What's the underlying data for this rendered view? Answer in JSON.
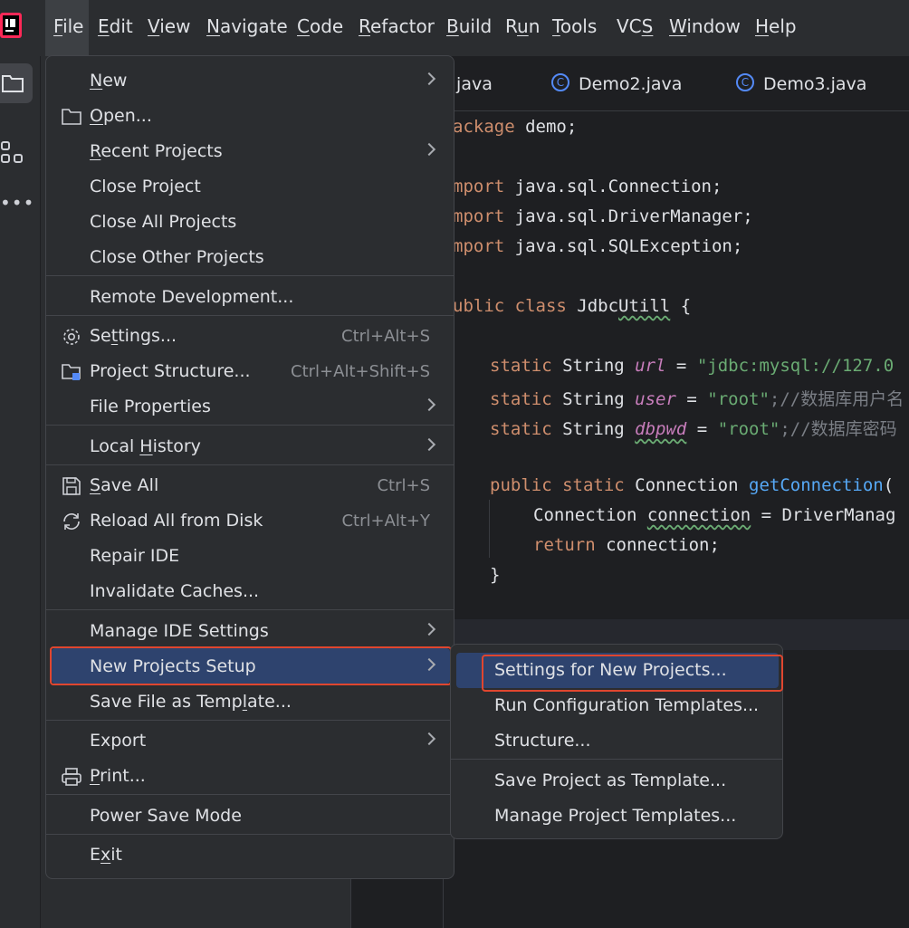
{
  "menubar": {
    "items": [
      {
        "label": "File",
        "mnemonic": "F",
        "rest": "ile"
      },
      {
        "label": "Edit",
        "mnemonic": "E",
        "rest": "dit"
      },
      {
        "label": "View",
        "mnemonic": "V",
        "rest": "iew"
      },
      {
        "label": "Navigate",
        "mnemonic": "N",
        "rest": "avigate"
      },
      {
        "label": "Code",
        "mnemonic": "C",
        "rest": "ode"
      },
      {
        "label": "Refactor",
        "mnemonic": "R",
        "rest": "efactor"
      },
      {
        "label": "Build",
        "mnemonic": "B",
        "rest": "uild"
      },
      {
        "label": "Run",
        "pre": "R",
        "mnemonic": "u",
        "rest": "n"
      },
      {
        "label": "Tools",
        "mnemonic": "T",
        "rest": "ools"
      },
      {
        "label": "VCS",
        "pre": "VC",
        "mnemonic": "S",
        "rest": ""
      },
      {
        "label": "Window",
        "mnemonic": "W",
        "rest": "indow"
      },
      {
        "label": "Help",
        "mnemonic": "H",
        "rest": "elp"
      }
    ]
  },
  "editor": {
    "tabs": [
      ".java",
      "Demo2.java",
      "Demo3.java"
    ],
    "tab_icon_letter": "C",
    "code": {
      "l1": [
        "ackage",
        " demo;"
      ],
      "l2": [
        "mport",
        " java.sql.Connection;"
      ],
      "l3": [
        "mport",
        " java.sql.DriverManager;"
      ],
      "l4": [
        "mport",
        " java.sql.SQLException;"
      ],
      "l5": [
        "ublic class",
        " Jdbc",
        "Utill",
        " {"
      ],
      "l6": [
        "static",
        " String ",
        "url",
        " = ",
        "\"jdbc:mysql://127.0"
      ],
      "l7": [
        "static",
        " String ",
        "user",
        " = ",
        "\"root\"",
        ";//数据库用户名"
      ],
      "l8": [
        "static",
        " String ",
        "dbpwd",
        " = ",
        "\"root\"",
        ";//数据库密码"
      ],
      "l9": [
        "public static",
        " Connection ",
        "getConnection",
        "("
      ],
      "l10": [
        "Connection ",
        "connection",
        " = DriverManag"
      ],
      "l11": [
        "return",
        " connection;"
      ],
      "l12": [
        "}"
      ]
    }
  },
  "file_menu": {
    "items": {
      "new": {
        "mn": "N",
        "rest": "ew"
      },
      "open": {
        "mn": "O",
        "rest": "pen..."
      },
      "recent": {
        "mn": "R",
        "rest": "ecent Projects"
      },
      "close_project": "Close Project",
      "close_all": "Close All Projects",
      "close_other": "Close Other Projects",
      "remote_dev": "Remote Development...",
      "settings": {
        "pre": "Se",
        "mn": "t",
        "rest": "tings...",
        "shortcut": "Ctrl+Alt+S"
      },
      "project_structure": {
        "label": "Project Structure...",
        "shortcut": "Ctrl+Alt+Shift+S"
      },
      "file_properties": "File Properties",
      "local_history": {
        "pre": "Local ",
        "mn": "H",
        "rest": "istory"
      },
      "save_all": {
        "mn": "S",
        "rest": "ave All",
        "shortcut": "Ctrl+S"
      },
      "reload": {
        "label": "Reload All from Disk",
        "shortcut": "Ctrl+Alt+Y"
      },
      "repair": "Repair IDE",
      "invalidate": "Invalidate Caches...",
      "manage_settings": "Manage IDE Settings",
      "new_projects_setup": "New Projects Setup",
      "save_template": {
        "pre": "Save File as Temp",
        "mn": "l",
        "rest": "ate..."
      },
      "export": "Export",
      "print": {
        "mn": "P",
        "rest": "rint..."
      },
      "power_save": "Power Save Mode",
      "exit": {
        "pre": "E",
        "mn": "x",
        "rest": "it"
      }
    }
  },
  "submenu": {
    "items": [
      "Settings for New Projects...",
      "Run Configuration Templates...",
      "Structure...",
      "Save Project as Template...",
      "Manage Project Templates..."
    ]
  },
  "colors": {
    "accent_selection": "#2e436e",
    "highlight_box": "#e0462f",
    "keyword": "#cf8e6d",
    "string": "#6aab73"
  }
}
